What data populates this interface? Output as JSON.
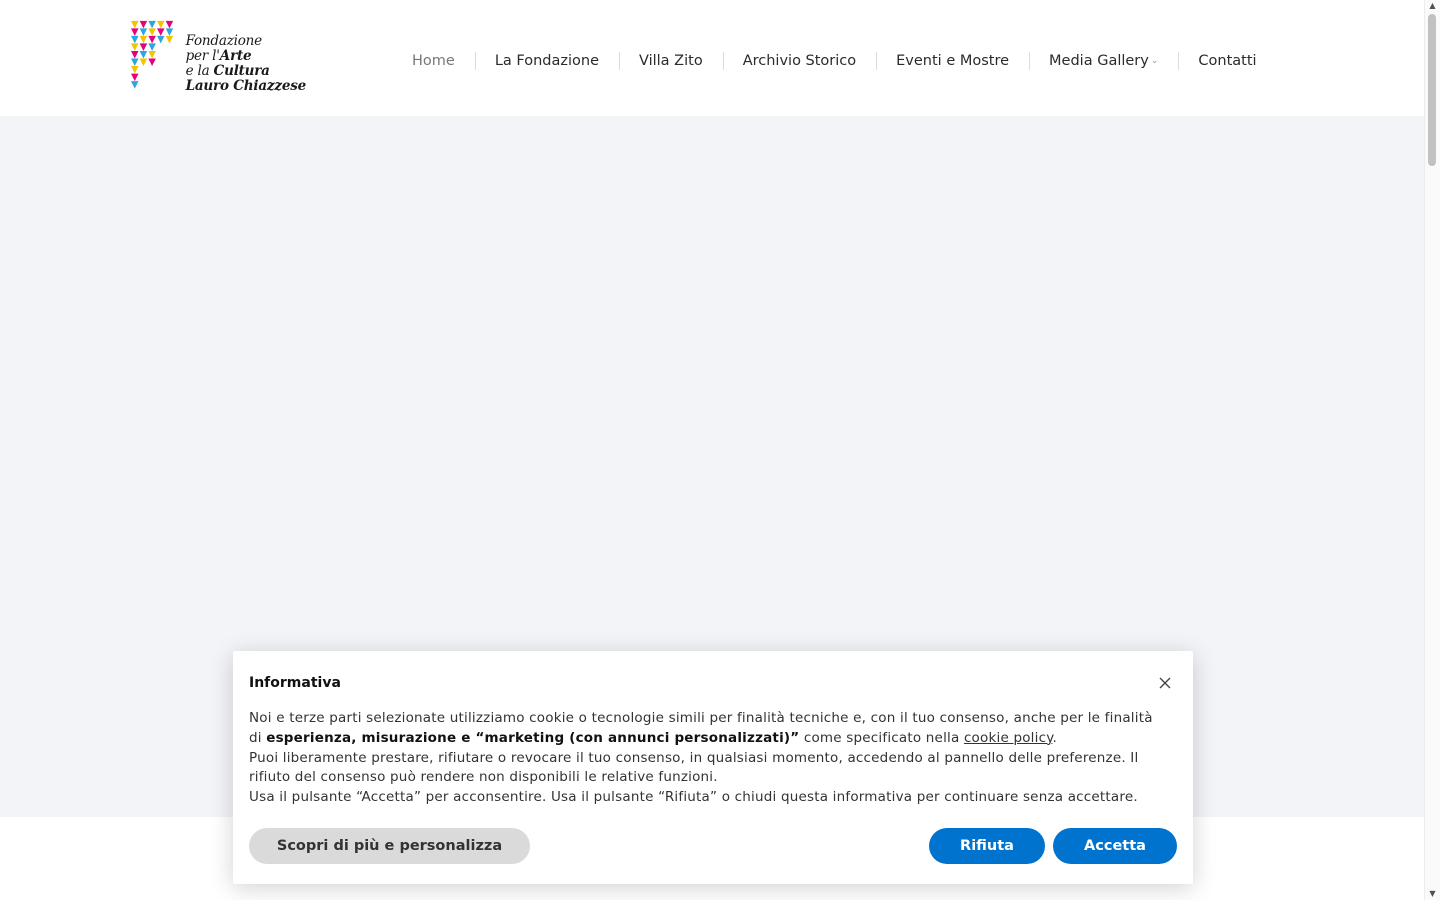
{
  "logo": {
    "line1": "Fondazione",
    "line2_a": "per l'",
    "line2_b": "Arte",
    "line3_a": "e la ",
    "line3_b": "Cultura",
    "line4": "Lauro Chiazzese",
    "colors": [
      "#f5c400",
      "#e6007e",
      "#2aa7df"
    ]
  },
  "nav": {
    "items": [
      {
        "label": "Home"
      },
      {
        "label": "La Fondazione"
      },
      {
        "label": "Villa Zito"
      },
      {
        "label": "Archivio Storico"
      },
      {
        "label": "Eventi e Mostre"
      },
      {
        "label": "Media Gallery"
      },
      {
        "label": "Contatti"
      }
    ],
    "active": "Home"
  },
  "cookie": {
    "title": "Informativa",
    "p1_a": "Noi e terze parti selezionate utilizziamo cookie o tecnologie simili per finalità tecniche e, con il tuo consenso, anche per le finalità di ",
    "p1_b": "esperienza, misurazione e “marketing (con annunci personalizzati)”",
    "p1_c": " come specificato nella ",
    "p1_link": "cookie policy",
    "p1_d": ".",
    "p2": "Puoi liberamente prestare, rifiutare o revocare il tuo consenso, in qualsiasi momento, accedendo al pannello delle preferenze. Il rifiuto del consenso può rendere non disponibili le relative funzioni.",
    "p3": "Usa il pulsante “Accetta” per acconsentire. Usa il pulsante “Rifiuta” o chiudi questa informativa per continuare senza accettare.",
    "btn_more": "Scopri di più e personalizza",
    "btn_reject": "Rifiuta",
    "btn_accept": "Accetta",
    "accent": "#0073ce"
  }
}
